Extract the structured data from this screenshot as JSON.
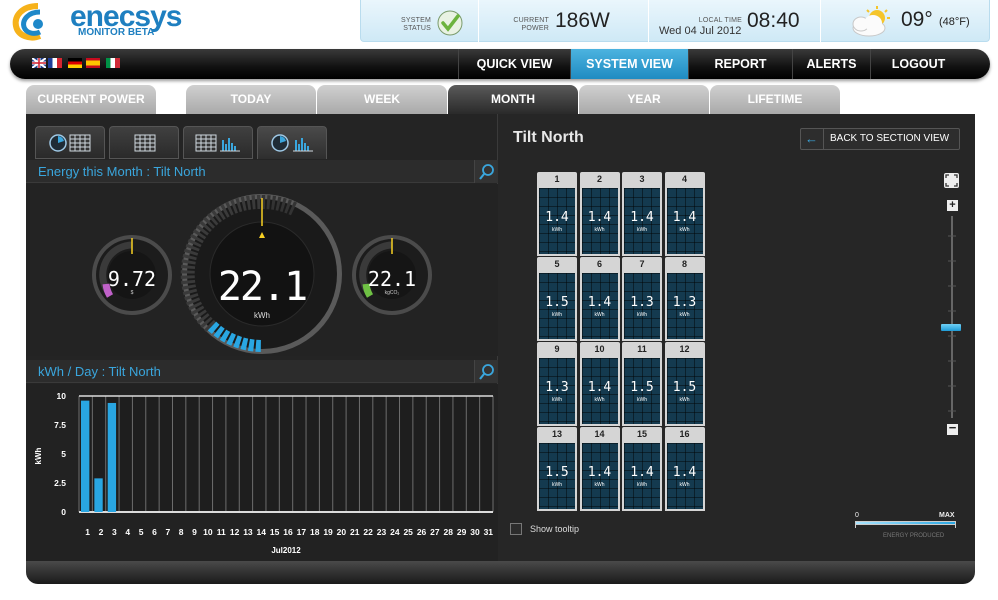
{
  "header": {
    "logo_name": "enecsys",
    "logo_sub": "MONITOR BETA",
    "system_status_label": "SYSTEM STATUS",
    "current_power_label": "CURRENT POWER",
    "current_power_value": "186W",
    "local_time_label": "LOCAL TIME",
    "local_date": "Wed 04 Jul 2012",
    "local_time": "08:40",
    "weather_temp": "09°",
    "weather_temp_f": "(48°F)"
  },
  "nav": {
    "flags": [
      "gb",
      "fr",
      "de",
      "es",
      "it"
    ],
    "items": [
      "QUICK VIEW",
      "SYSTEM VIEW",
      "REPORT",
      "ALERTS",
      "LOGOUT"
    ],
    "active": "SYSTEM VIEW"
  },
  "tabs": {
    "items": [
      "CURRENT POWER",
      "TODAY",
      "WEEK",
      "MONTH",
      "YEAR",
      "LIFETIME"
    ],
    "active": "MONTH"
  },
  "energy": {
    "title": "Energy this Month : Tilt North",
    "main_value": "22.1",
    "main_unit": "kWh",
    "left_value": "9.72",
    "left_unit": "$",
    "right_value": "22.1",
    "right_unit": "kgCO₂"
  },
  "chart_section_title": "kWh / Day : Tilt North",
  "chart_data": {
    "type": "bar",
    "ylabel": "kWh",
    "xlabel": "Jul2012",
    "ylim": [
      0,
      10
    ],
    "yticks": [
      "0",
      "2.5",
      "5",
      "7.5",
      "10"
    ],
    "categories": [
      "1",
      "2",
      "3",
      "4",
      "5",
      "6",
      "7",
      "8",
      "9",
      "10",
      "11",
      "12",
      "13",
      "14",
      "15",
      "16",
      "17",
      "18",
      "19",
      "20",
      "21",
      "22",
      "23",
      "24",
      "25",
      "26",
      "27",
      "28",
      "29",
      "30",
      "31"
    ],
    "values": [
      9.6,
      2.9,
      9.4,
      0,
      0,
      0,
      0,
      0,
      0,
      0,
      0,
      0,
      0,
      0,
      0,
      0,
      0,
      0,
      0,
      0,
      0,
      0,
      0,
      0,
      0,
      0,
      0,
      0,
      0,
      0,
      0
    ],
    "bar_color": "#29a6e2"
  },
  "system": {
    "title": "Tilt North",
    "back_label": "BACK TO SECTION VIEW",
    "panels": [
      {
        "num": "1",
        "value": "1.4",
        "unit": "kWh"
      },
      {
        "num": "2",
        "value": "1.4",
        "unit": "kWh"
      },
      {
        "num": "3",
        "value": "1.4",
        "unit": "kWh"
      },
      {
        "num": "4",
        "value": "1.4",
        "unit": "kWh"
      },
      {
        "num": "5",
        "value": "1.5",
        "unit": "kWh"
      },
      {
        "num": "6",
        "value": "1.4",
        "unit": "kWh"
      },
      {
        "num": "7",
        "value": "1.3",
        "unit": "kWh"
      },
      {
        "num": "8",
        "value": "1.3",
        "unit": "kWh"
      },
      {
        "num": "9",
        "value": "1.3",
        "unit": "kWh"
      },
      {
        "num": "10",
        "value": "1.4",
        "unit": "kWh"
      },
      {
        "num": "11",
        "value": "1.5",
        "unit": "kWh"
      },
      {
        "num": "12",
        "value": "1.5",
        "unit": "kWh"
      },
      {
        "num": "13",
        "value": "1.5",
        "unit": "kWh"
      },
      {
        "num": "14",
        "value": "1.4",
        "unit": "kWh"
      },
      {
        "num": "15",
        "value": "1.4",
        "unit": "kWh"
      },
      {
        "num": "16",
        "value": "1.4",
        "unit": "kWh"
      }
    ],
    "show_tooltip_label": "Show tooltip",
    "legend_min": "0",
    "legend_max": "MAX",
    "legend_label": "ENERGY PRODUCED",
    "zoom_level": 0.45
  },
  "colors": {
    "accent": "#29a6e2",
    "nav_active": "#2f9dd4",
    "status_ok": "#6cb33e"
  }
}
